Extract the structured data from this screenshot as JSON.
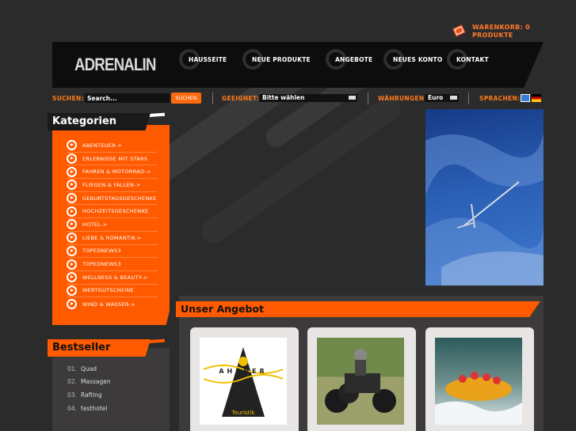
{
  "brand": {
    "logo": "ADRENALIN"
  },
  "cart": {
    "line1": "WARENKORB: 0",
    "line2": "PRODUKTE"
  },
  "nav": {
    "items": [
      {
        "label": "HAUSSEITE"
      },
      {
        "label": "NEUE PRODUKTE"
      },
      {
        "label": "ANGEBOTE"
      },
      {
        "label": "NEUES KONTO"
      },
      {
        "label": "KONTAKT"
      }
    ]
  },
  "toolbar": {
    "search_label": "SUCHEN:",
    "search_value": "Search...",
    "search_button": "SUCHEN",
    "suitable_label": "GEEIGNET:",
    "suitable_value": "Bitte wählen",
    "currency_label": "WÄHRUNGEN:",
    "currency_value": "Euro",
    "language_label": "SPRACHEN:"
  },
  "categories": {
    "title": "Kategorien",
    "items": [
      "ABENTEUER->",
      "ERLEBNISSE MIT STARS",
      "FAHREN & MOTORRAD->",
      "FLIEGEN & FALLEN->",
      "GEBURTSTAGSGESCHENKE",
      "HOCHZEITSGESCHENKE",
      "HOTEL->",
      "LIEBE & ROMANTIK->",
      "TOPEDNEWS3",
      "TOPEDNEWS3",
      "WELLNESS & BEAUTY->",
      "WERTGUTSCHEINE",
      "WIND & WASSER->"
    ]
  },
  "bestseller": {
    "title": "Bestseller",
    "items": [
      {
        "num": "01.",
        "label": "Quad"
      },
      {
        "num": "02.",
        "label": "Massagen"
      },
      {
        "num": "03.",
        "label": "Rafting"
      },
      {
        "num": "04.",
        "label": "testhotel"
      }
    ]
  },
  "main": {
    "offer_title": "Unser Angebot",
    "products": [
      {
        "logo_top": "AHRNER",
        "logo_bottom": "Touristik"
      },
      {
        "image": "quad-photo"
      },
      {
        "image": "rafting-photo"
      }
    ]
  },
  "colors": {
    "accent": "#ff5a00",
    "background": "#2c2b2b",
    "header": "#0d0d0d"
  }
}
